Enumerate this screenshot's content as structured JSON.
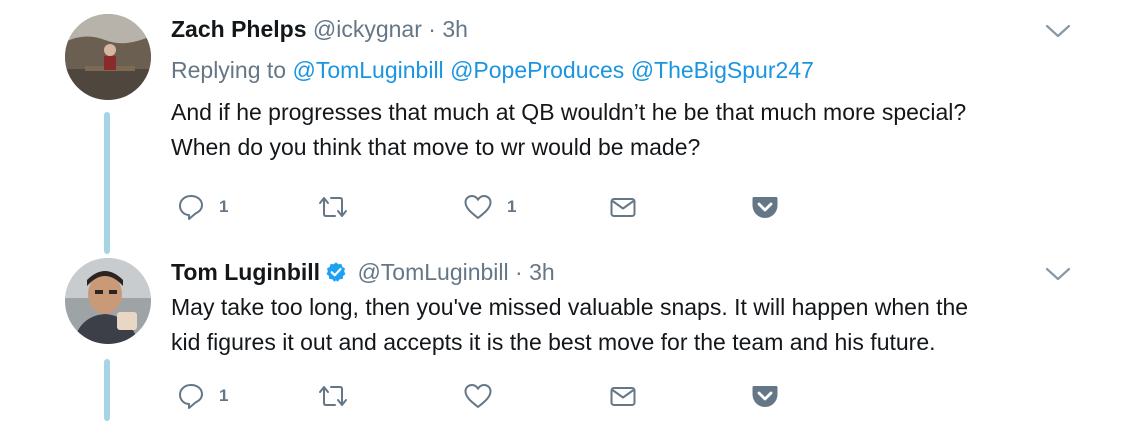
{
  "tweets": [
    {
      "name": "Zach Phelps",
      "handle": "@ickygnar",
      "separator": "·",
      "time": "3h",
      "verified": false,
      "replying": {
        "prefix": "Replying to",
        "mentions": [
          "@TomLuginbill",
          "@PopeProduces",
          "@TheBigSpur247"
        ]
      },
      "lines": [
        "And if he progresses that much at QB wouldn’t he be that much more special?",
        "When do you think that move to wr would be made?"
      ],
      "actions": {
        "reply_count": "1",
        "retweet_count": "",
        "like_count": "1"
      }
    },
    {
      "name": "Tom Luginbill",
      "handle": "@TomLuginbill",
      "separator": "·",
      "time": "3h",
      "verified": true,
      "lines": [
        "May take too long, then you've missed valuable snaps. It will happen when the",
        "kid figures it out and accepts it is the best move for the team and his future."
      ],
      "actions": {
        "reply_count": "1",
        "retweet_count": "",
        "like_count": ""
      }
    }
  ],
  "colors": {
    "text": "#14171a",
    "muted": "#657786",
    "link": "#1b95e0",
    "thread_line": "#a6d4e4",
    "verified": "#1da1f2",
    "pocket": "#657786"
  },
  "icons": [
    "chevron-down-icon",
    "reply-icon",
    "retweet-icon",
    "heart-icon",
    "envelope-icon",
    "pocket-icon",
    "verified-badge-icon"
  ]
}
